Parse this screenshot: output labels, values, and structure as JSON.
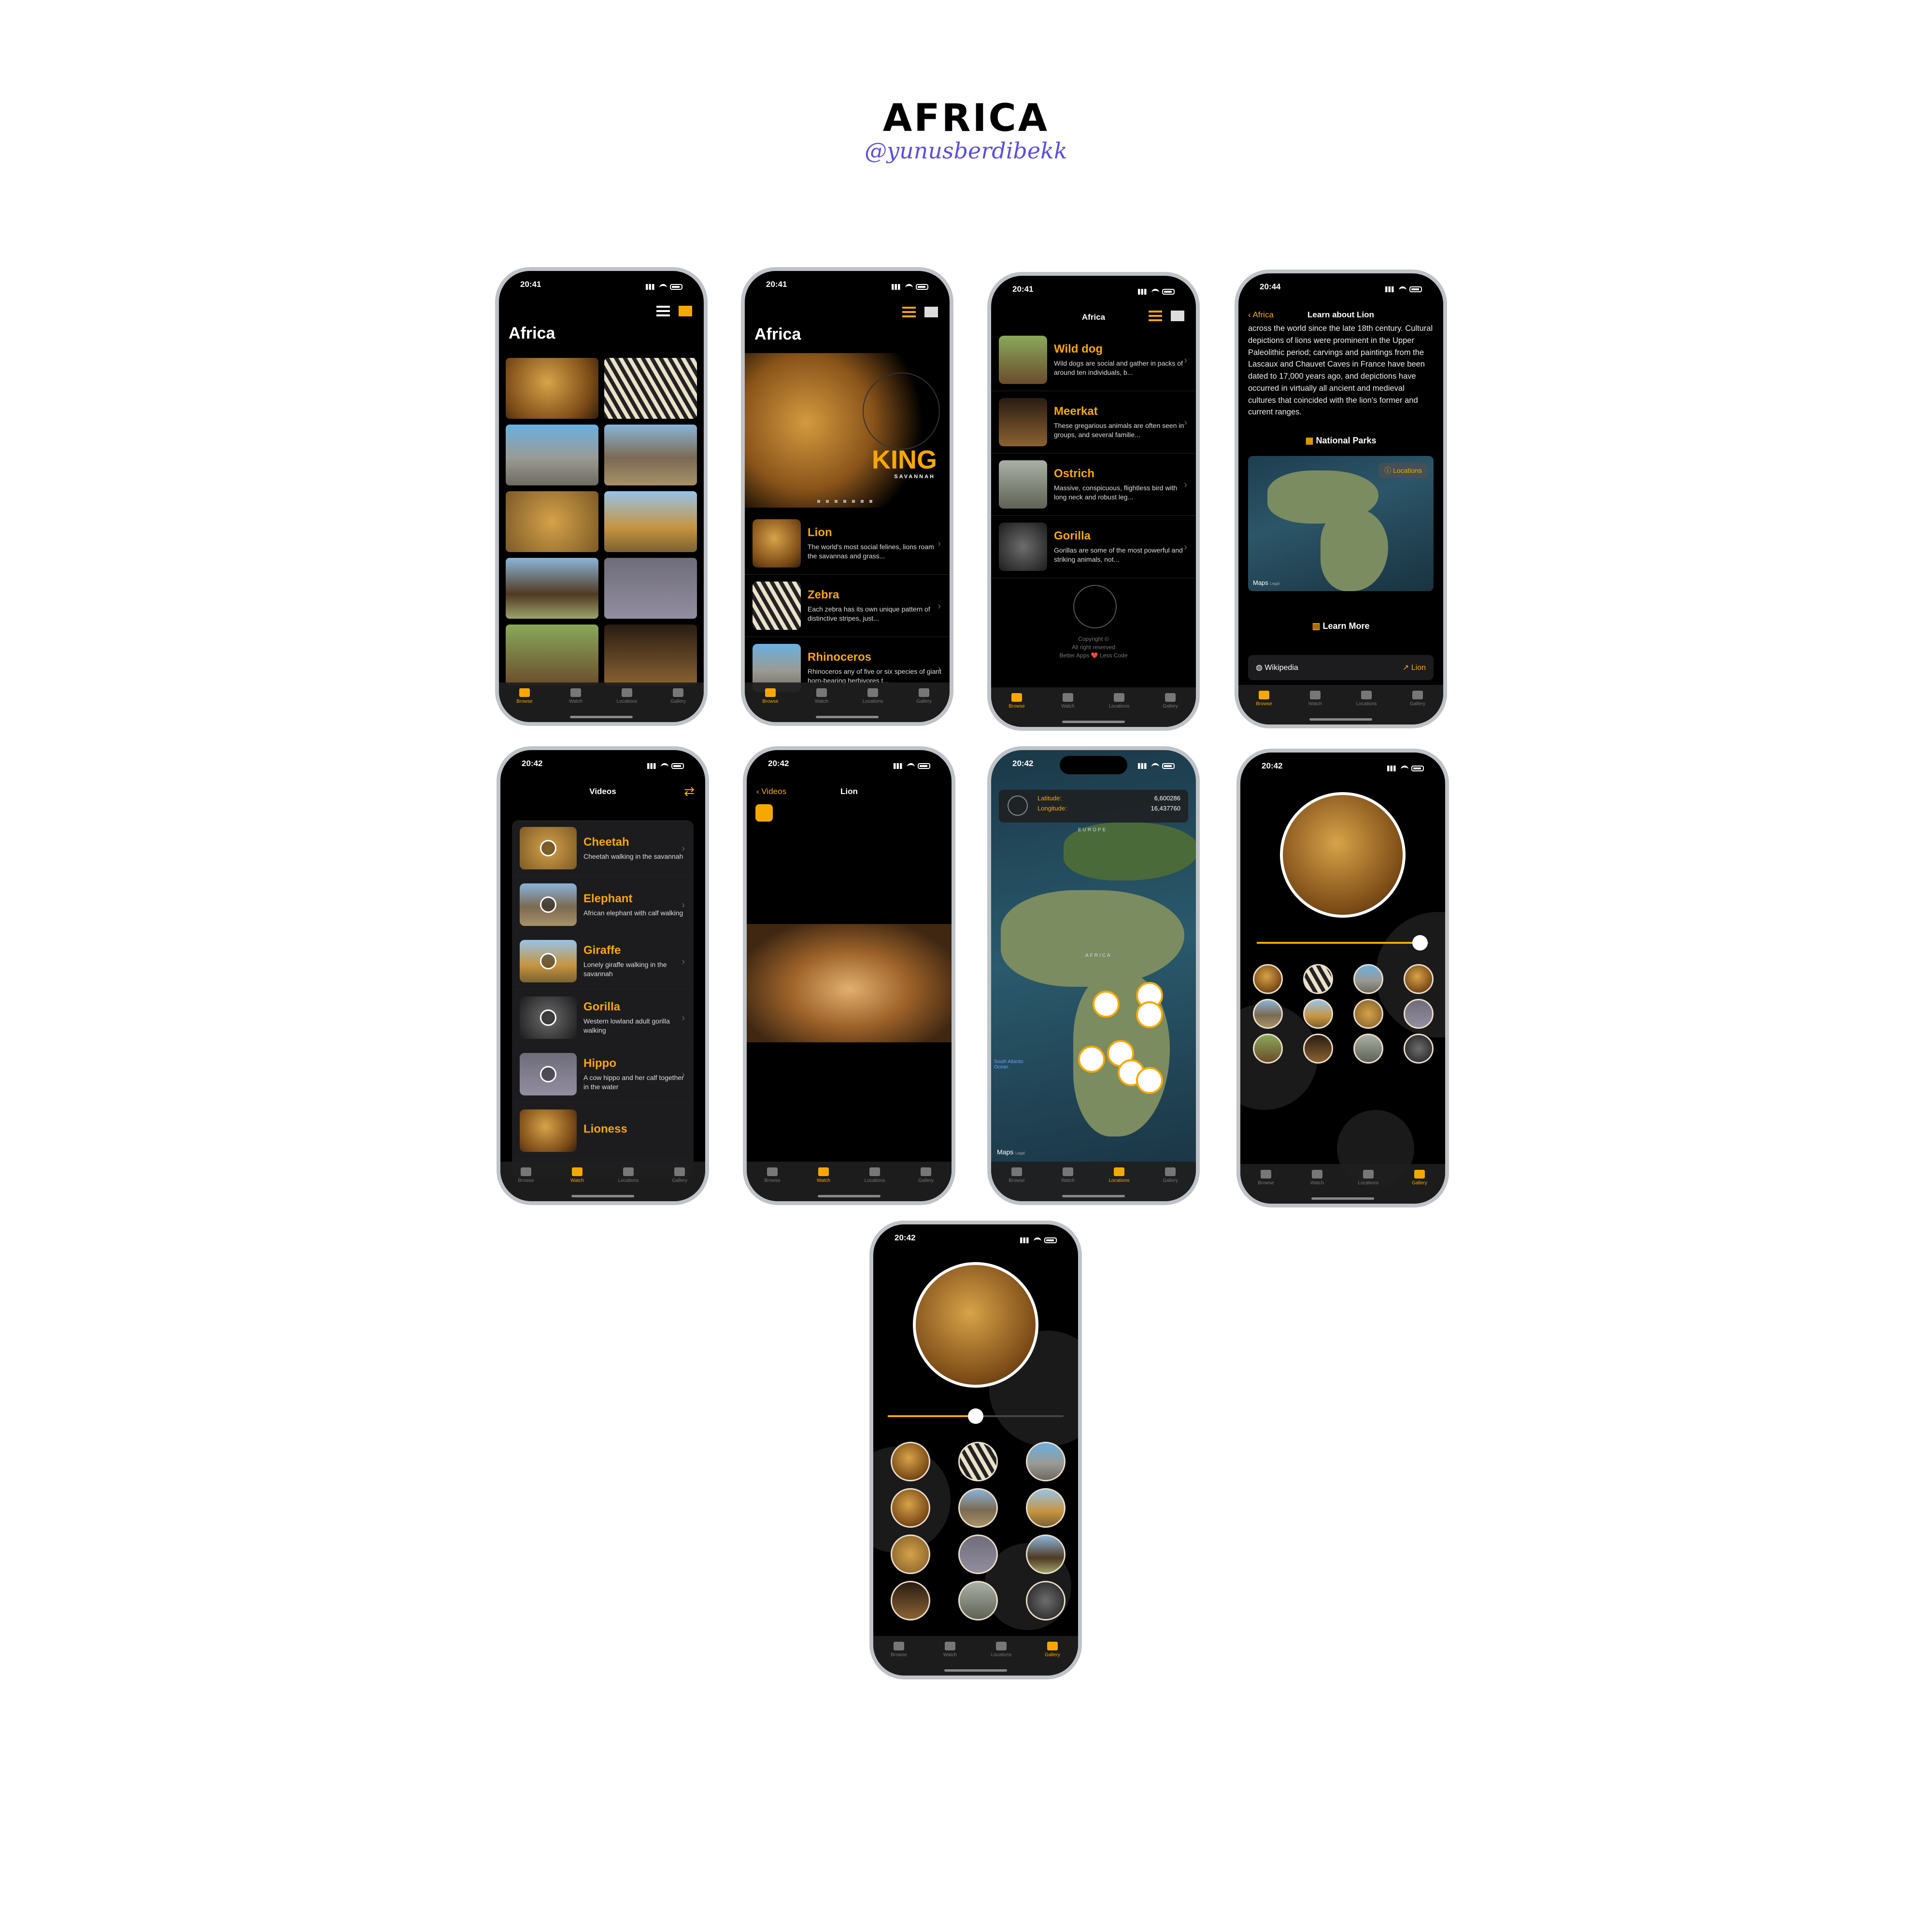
{
  "header": {
    "title": "AFRICA",
    "handle": "@yunusberdibekk"
  },
  "tabs": [
    "Browse",
    "Watch",
    "Locations",
    "Gallery"
  ],
  "icons": [
    "list-view-icon",
    "grid-view-icon",
    "chevron-right-icon",
    "play-icon",
    "compass-icon",
    "map-icon",
    "globe-icon",
    "external-link-icon",
    "shuffle-icon",
    "lion-logo-icon"
  ],
  "screen1": {
    "time": "20:41",
    "title": "Africa"
  },
  "screen2": {
    "time": "20:41",
    "title": "Africa",
    "hero_word": "KING",
    "hero_sub": "SAVANNAH",
    "rows": [
      {
        "title": "Lion",
        "desc": "The world's most social felines, lions roam the savannas and grass..."
      },
      {
        "title": "Zebra",
        "desc": "Each zebra has its own unique pattern of distinctive stripes, just..."
      },
      {
        "title": "Rhinoceros",
        "desc": "Rhinoceros any of five or six species of giant horn-bearing herbivores t..."
      }
    ]
  },
  "screen3": {
    "time": "20:41",
    "title": "Africa",
    "rows": [
      {
        "title": "Wild dog",
        "desc": "Wild dogs are social and gather in packs of around ten individuals, b..."
      },
      {
        "title": "Meerkat",
        "desc": "These gregarious animals are often seen in groups, and several familie..."
      },
      {
        "title": "Ostrich",
        "desc": "Massive, conspicuous, flightless bird with long neck and robust leg..."
      },
      {
        "title": "Gorilla",
        "desc": "Gorillas are some of the most powerful and striking animals, not..."
      }
    ],
    "footer1": "Copyright ©",
    "footer2": "All right reserved",
    "footer3": "Better Apps ❤️ Less Code"
  },
  "screen4": {
    "time": "20:44",
    "back": "Africa",
    "title": "Learn about Lion",
    "body": "across the world since the late 18th century. Cultural depictions of lions were prominent in the Upper Paleolithic period; carvings and paintings from the Lascaux and Chauvet Caves in France have been dated to 17,000 years ago, and depictions have occurred in virtually all ancient and medieval cultures that coincided with the lion's former and current ranges.",
    "parks": "National Parks",
    "locations": "Locations",
    "maps": "Maps",
    "legal": "Legal",
    "learn": "Learn More",
    "wiki": "Wikipedia",
    "wiki_link": "Lion"
  },
  "screen5": {
    "time": "20:42",
    "title": "Videos",
    "rows": [
      {
        "title": "Cheetah",
        "desc": "Cheetah walking in the savannah"
      },
      {
        "title": "Elephant",
        "desc": "African elephant with calf walking"
      },
      {
        "title": "Giraffe",
        "desc": "Lonely giraffe walking in the savannah"
      },
      {
        "title": "Gorilla",
        "desc": "Western lowland adult gorilla walking"
      },
      {
        "title": "Hippo",
        "desc": "A cow hippo and her calf together in the water"
      },
      {
        "title": "Lioness",
        "desc": ""
      }
    ]
  },
  "screen6": {
    "time": "20:42",
    "back": "Videos",
    "title": "Lion"
  },
  "screen7": {
    "time": "20:42",
    "lat_label": "Latitude:",
    "lat": "6,600286",
    "lon_label": "Longitude:",
    "lon": "16,437760",
    "europe": "EUROPE",
    "africa": "AFRICA",
    "ocean": "South Atlantic Ocean",
    "maps": "Maps",
    "legal": "Legal"
  },
  "screen8": {
    "time": "20:42",
    "slider": 0.95
  },
  "screen9": {
    "time": "20:42",
    "slider": 0.5
  }
}
